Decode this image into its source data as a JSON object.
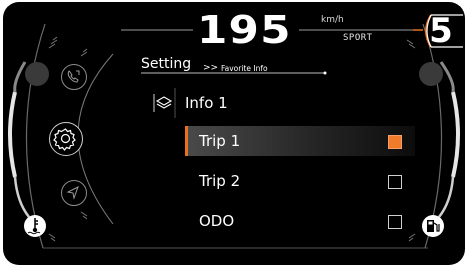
{
  "header": {
    "speed": "195",
    "speed_unit": "km/h",
    "drive_mode": "SPORT",
    "gear": "5"
  },
  "breadcrumb": {
    "section": "Setting",
    "separator": ">>",
    "subsection": "Favorite Info"
  },
  "menu": {
    "title": "Info 1",
    "title_icon": "layers-icon",
    "items": [
      {
        "label": "Trip 1",
        "checked": true,
        "selected": true
      },
      {
        "label": "Trip  2",
        "checked": false,
        "selected": false
      },
      {
        "label": "ODO",
        "checked": false,
        "selected": false
      }
    ]
  },
  "side_icons": [
    "phone-icon",
    "settings-gear-icon",
    "navigation-arrow-icon"
  ],
  "gauge_icons": [
    "coolant-temperature-icon",
    "fuel-pump-icon"
  ],
  "colors": {
    "accent": "#f07c2a",
    "background": "#000000",
    "text": "#ffffff"
  }
}
